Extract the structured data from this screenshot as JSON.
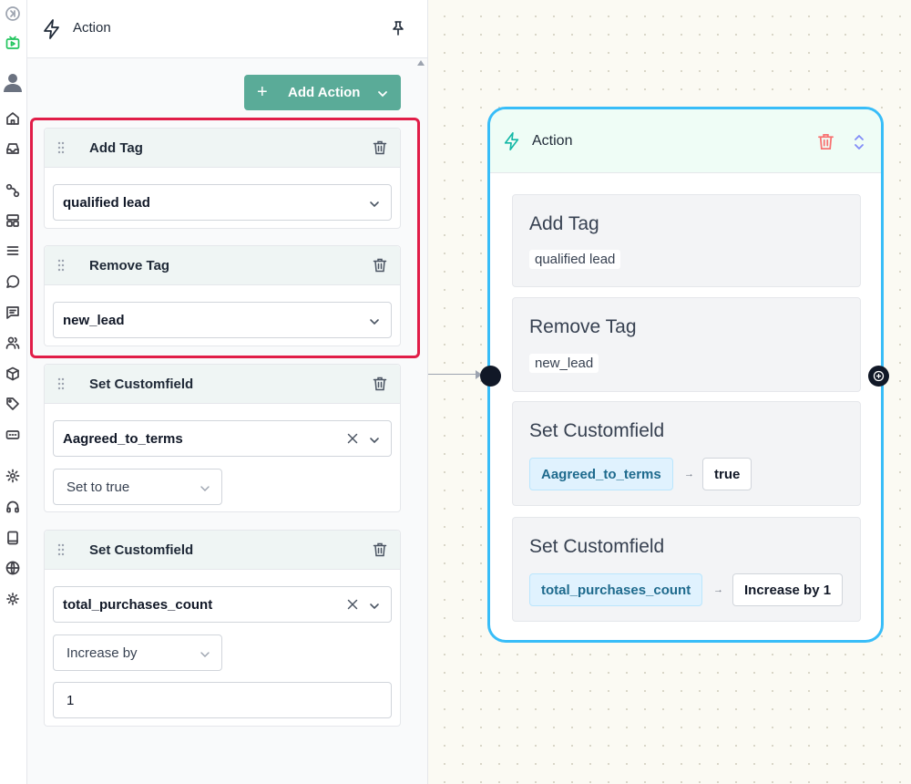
{
  "panel": {
    "title": "Action",
    "add_action_label": "Add Action",
    "cards": [
      {
        "title": "Add Tag",
        "select_value": "qualified lead"
      },
      {
        "title": "Remove Tag",
        "select_value": "new_lead"
      },
      {
        "title": "Set Customfield",
        "field_value": "Aagreed_to_terms",
        "operation_value": "Set to true"
      },
      {
        "title": "Set Customfield",
        "field_value": "total_purchases_count",
        "operation_value": "Increase by",
        "amount_value": "1"
      }
    ]
  },
  "node": {
    "title": "Action",
    "items": [
      {
        "title": "Add Tag",
        "tag": "qualified lead"
      },
      {
        "title": "Remove Tag",
        "tag": "new_lead"
      },
      {
        "title": "Set Customfield",
        "field": "Aagreed_to_terms",
        "value": "true"
      },
      {
        "title": "Set Customfield",
        "field": "total_purchases_count",
        "value": "Increase by 1"
      }
    ]
  },
  "colors": {
    "accent": "#5aab98",
    "highlight": "#e11d48",
    "node_border": "#38bdf8",
    "chip_bg": "#e0f2fe"
  },
  "icons": {
    "rail": [
      "expand-icon",
      "video-icon",
      "user-avatar-icon",
      "home-icon",
      "inbox-icon",
      "flow-icon",
      "layout-icon",
      "list-icon",
      "chat-bubble-icon",
      "message-icon",
      "users-icon",
      "package-icon",
      "tag-icon",
      "ticket-icon",
      "settings-icon",
      "headset-icon",
      "book-icon",
      "globe-icon",
      "sun-icon"
    ]
  }
}
